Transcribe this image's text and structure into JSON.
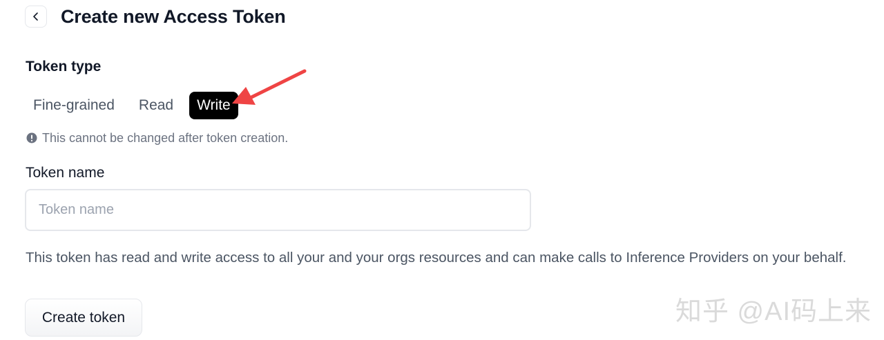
{
  "header": {
    "back_icon": "chevron-left-icon",
    "title": "Create new Access Token"
  },
  "token_type": {
    "label": "Token type",
    "options": [
      "Fine-grained",
      "Read",
      "Write"
    ],
    "selected": "Write",
    "notice_icon": "info-circle-icon",
    "notice": "This cannot be changed after token creation."
  },
  "token_name": {
    "label": "Token name",
    "value": "",
    "placeholder": "Token name"
  },
  "description": "This token has read and write access to all your and your orgs resources and can make calls to Inference Providers on your behalf.",
  "create_button": {
    "label": "Create token"
  },
  "annotation": {
    "icon": "red-arrow-icon",
    "color": "#ef4444"
  },
  "watermark": "知乎 @AI码上来",
  "colors": {
    "selected_bg": "#000000",
    "selected_text": "#ffffff",
    "muted_text": "#4b5563"
  }
}
